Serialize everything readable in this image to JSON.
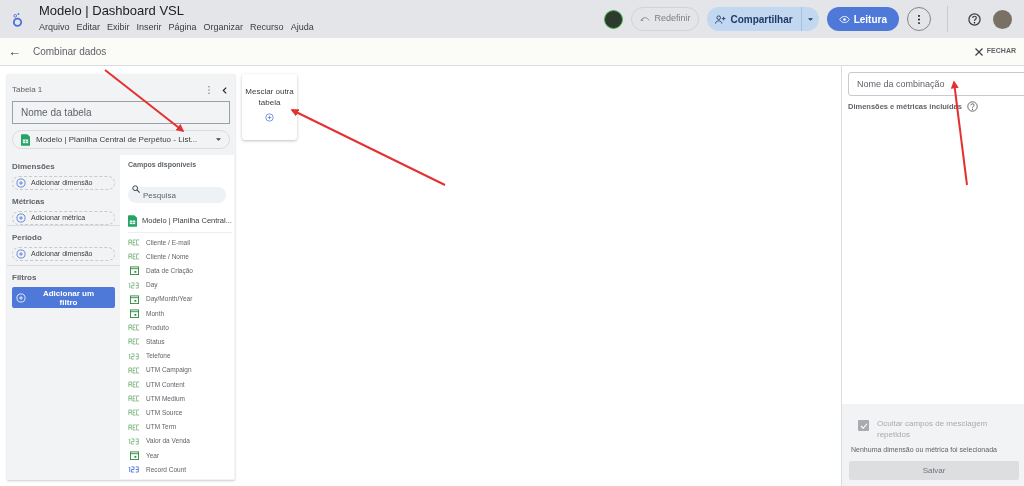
{
  "header": {
    "title": "Modelo | Dashboard VSL",
    "menu": [
      "Arquivo",
      "Editar",
      "Exibir",
      "Inserir",
      "Página",
      "Organizar",
      "Recurso",
      "Ajuda"
    ],
    "reset_button": {
      "label": "Redefinir",
      "disabled": true
    },
    "share_button": {
      "label": "Compartilhar"
    },
    "read_button": {
      "label": "Leitura"
    }
  },
  "subheader": {
    "back_icon": "←",
    "title": "Combinar dados",
    "close_label": "FECHAR"
  },
  "table_panel": {
    "title": "Tabela 1",
    "name_placeholder": "Nome da tabela",
    "source": "Modelo | Planilha Central de Perpétuo - List...",
    "sections": [
      {
        "title": "Dimensões",
        "kind": "chip",
        "action": "Adicionar dimensão"
      },
      {
        "title": "Métricas",
        "kind": "chip",
        "action": "Adicionar métrica"
      },
      {
        "title": "Período",
        "kind": "chip",
        "action": "Adicionar dimensão"
      },
      {
        "title": "Filtros",
        "kind": "button",
        "action": "Adicionar um filtro"
      }
    ],
    "fields_title": "Campos disponíveis",
    "search_placeholder": "Pesquisa",
    "source_short": "Modelo | Planilha Central...",
    "fields": [
      {
        "kind": "text",
        "label": "Cliente / E-mail"
      },
      {
        "kind": "text",
        "label": "Cliente / Nome"
      },
      {
        "kind": "date",
        "label": "Data de Criação"
      },
      {
        "kind": "number",
        "label": "Day"
      },
      {
        "kind": "date",
        "label": "Day/Month/Year"
      },
      {
        "kind": "date",
        "label": "Month"
      },
      {
        "kind": "text",
        "label": "Produto"
      },
      {
        "kind": "text",
        "label": "Status"
      },
      {
        "kind": "number",
        "label": "Telefone"
      },
      {
        "kind": "text",
        "label": "UTM Campaign"
      },
      {
        "kind": "text",
        "label": "UTM Content"
      },
      {
        "kind": "text",
        "label": "UTM Medium"
      },
      {
        "kind": "text",
        "label": "UTM Source"
      },
      {
        "kind": "text",
        "label": "UTM Term"
      },
      {
        "kind": "number",
        "label": "Valor da Venda"
      },
      {
        "kind": "date",
        "label": "Year"
      },
      {
        "kind": "metric",
        "label": "Record Count"
      }
    ]
  },
  "merge_card": {
    "label": "Mesclar outra tabela"
  },
  "right_panel": {
    "name_placeholder": "Nome da combinação",
    "included_label": "Dimensões e métricas incluídas",
    "hide_repeated": {
      "label": "Ocultar campos de mesclagem repetidos",
      "checked": true,
      "disabled": true
    },
    "message": "Nenhuma dimensão ou métrica foi selecionada",
    "save_button": {
      "label": "Salvar",
      "disabled": true
    }
  }
}
